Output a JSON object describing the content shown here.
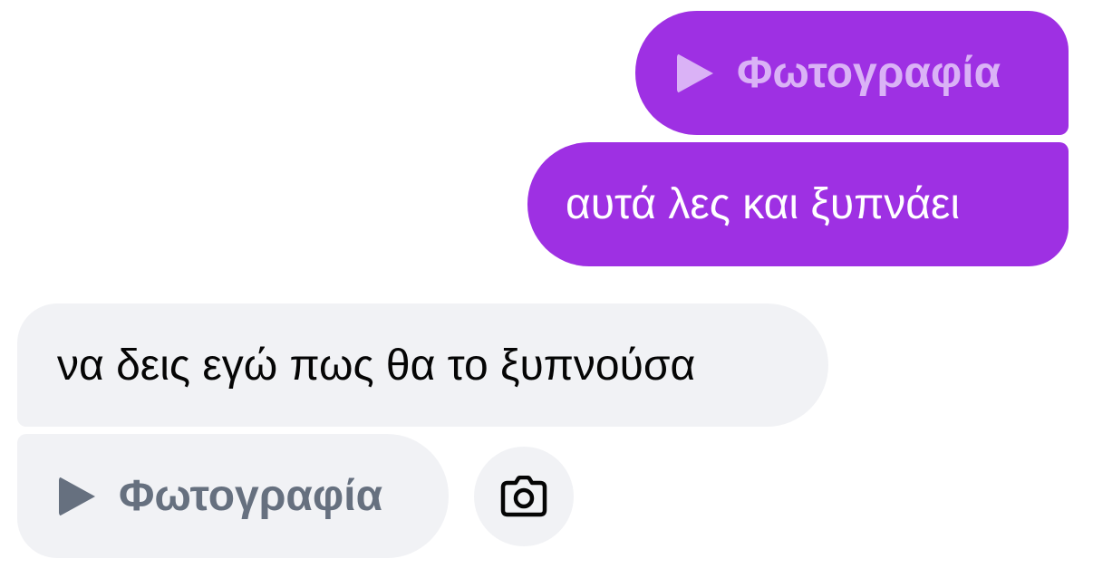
{
  "colors": {
    "outgoing_bubble": "#9e30e3",
    "incoming_bubble": "#f1f2f5",
    "outgoing_photo_label": "#dab2f6",
    "incoming_photo_label": "#66707f"
  },
  "messages": [
    {
      "direction": "outgoing",
      "type": "media",
      "icon": "play-icon",
      "label": "Φωτογραφία"
    },
    {
      "direction": "outgoing",
      "type": "text",
      "text": "αυτά λες και ξυπνάει"
    },
    {
      "direction": "incoming",
      "type": "text",
      "text": "να δεις εγώ πως θα το ξυπνούσα"
    },
    {
      "direction": "incoming",
      "type": "media",
      "icon": "play-icon",
      "label": "Φωτογραφία"
    }
  ],
  "actions": {
    "camera_icon": "camera-icon"
  }
}
